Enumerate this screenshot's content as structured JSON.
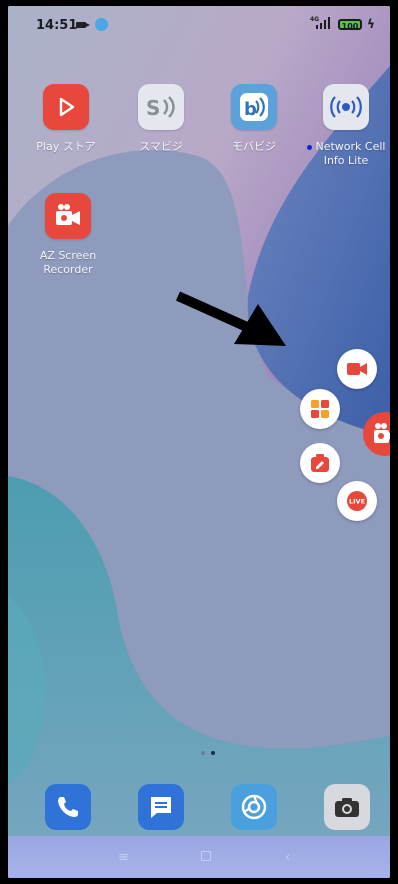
{
  "status_bar": {
    "time": "14:51",
    "network": "4G",
    "battery": "100"
  },
  "apps": [
    {
      "id": "play-store",
      "label": "Play ストア",
      "icon": "play-store-icon",
      "color": "#e8473c"
    },
    {
      "id": "sumabiji",
      "label": "スマビジ",
      "icon": "sumabiji-icon",
      "color": "#e4e7ee"
    },
    {
      "id": "mobabiji",
      "label": "モバビジ",
      "icon": "mobabiji-icon",
      "color": "#5aa2d9"
    },
    {
      "id": "network-cell",
      "label_line1": "Network Cell",
      "label_line2": "Info Lite",
      "icon": "network-cell-icon",
      "color": "#e4e7ee"
    },
    {
      "id": "az-screen",
      "label_line1": "AZ Screen",
      "label_line2": "Recorder",
      "icon": "az-recorder-icon",
      "color": "#e8473c"
    }
  ],
  "floating_menu": {
    "items": [
      "record-icon",
      "tools-grid-icon",
      "screenshot-icon",
      "live-icon"
    ],
    "live_label": "LIVE"
  },
  "dock": [
    "phone-icon",
    "messages-icon",
    "browser-icon",
    "camera-icon"
  ],
  "colors": {
    "accent": "#e8473c",
    "dock_blue": "#2f72d8"
  }
}
